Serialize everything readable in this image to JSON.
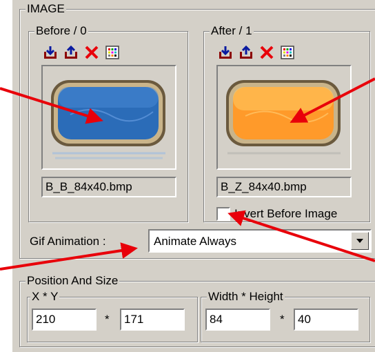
{
  "image_group": {
    "title": "IMAGE",
    "before": {
      "title": "Before / 0",
      "filename": "B_B_84x40.bmp",
      "button_color": "#2b6cb8"
    },
    "after": {
      "title": "After / 1",
      "filename": "B_Z_84x40.bmp",
      "button_color": "#ffa030"
    },
    "invert_label": "Invert Before Image",
    "invert_checked": false,
    "toolbar_icons": [
      "import-icon",
      "export-icon",
      "delete-icon",
      "palette-icon"
    ]
  },
  "gif_animation": {
    "label": "Gif Animation :",
    "value": "Animate Always"
  },
  "position_size": {
    "title": "Position And Size",
    "xy_title": "X * Y",
    "x": "210",
    "y": "171",
    "wh_title": "Width * Height",
    "width": "84",
    "height": "40",
    "separator": "*"
  },
  "colors": {
    "annotation_arrow": "#e8000a",
    "dialog_bg": "#d4d0c8"
  }
}
